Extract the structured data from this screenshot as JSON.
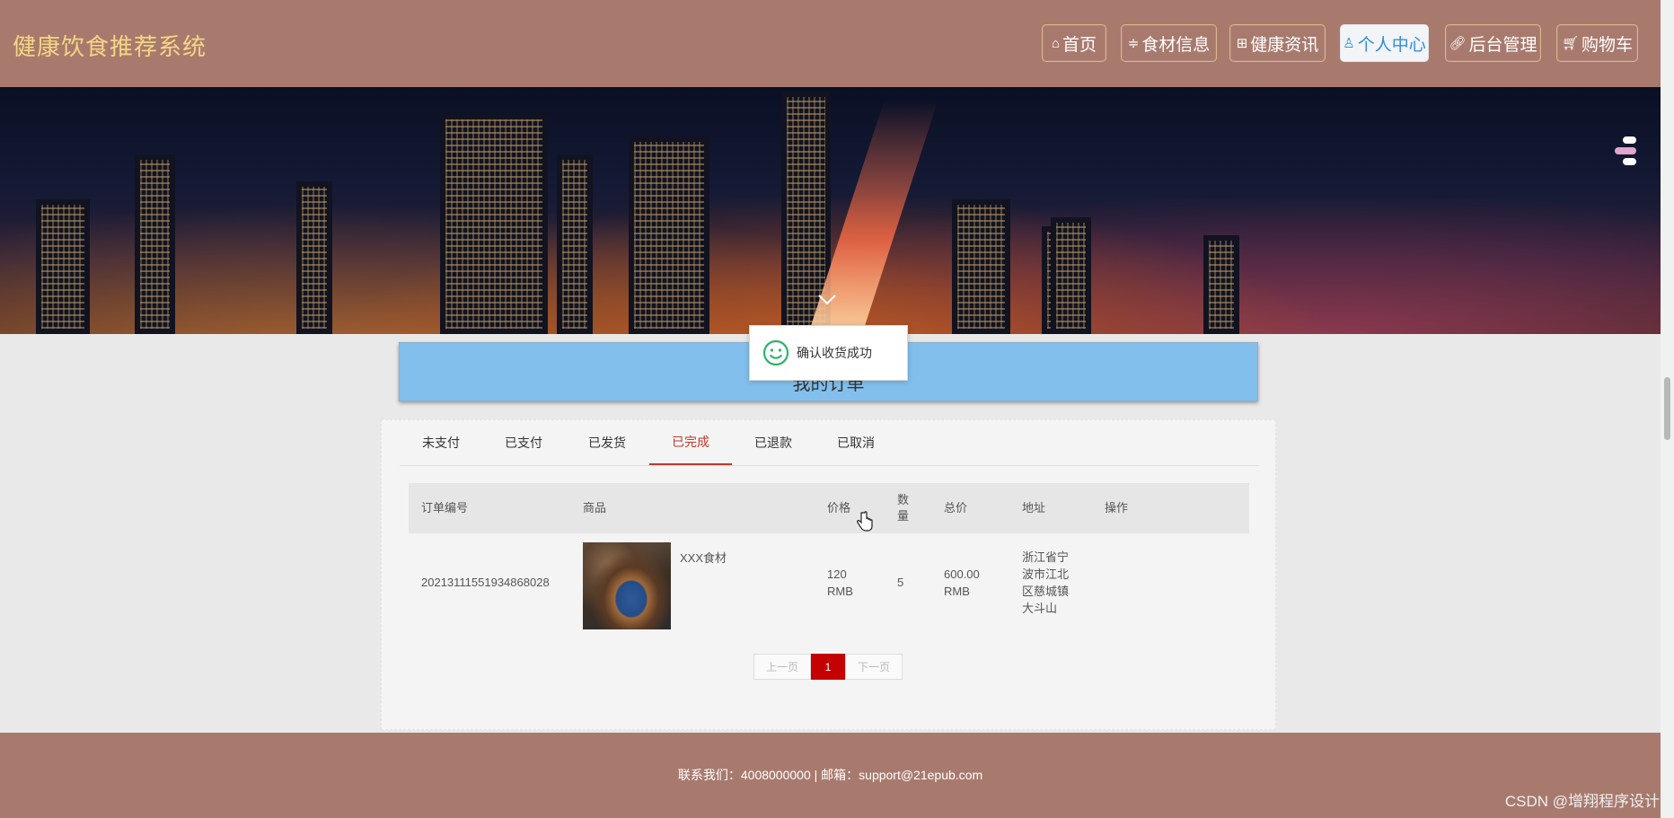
{
  "header": {
    "title": "健康饮食推荐系统",
    "nav": [
      {
        "label": "首页",
        "icon": "home-icon"
      },
      {
        "label": "食材信息",
        "icon": "sliders-icon"
      },
      {
        "label": "健康资讯",
        "icon": "gift-icon"
      },
      {
        "label": "个人中心",
        "icon": "user-icon",
        "active": true
      },
      {
        "label": "后台管理",
        "icon": "link-icon"
      },
      {
        "label": "购物车",
        "icon": "cart-icon"
      }
    ]
  },
  "section": {
    "title": "我的订单"
  },
  "toast": {
    "message": "确认收货成功"
  },
  "tabs": [
    "未支付",
    "已支付",
    "已发货",
    "已完成",
    "已退款",
    "已取消"
  ],
  "active_tab": "已完成",
  "table": {
    "headers": [
      "订单编号",
      "商品",
      "价格",
      "数量",
      "总价",
      "地址",
      "操作"
    ],
    "rows": [
      {
        "order_id": "202131115519348680​28",
        "product": "XXX食材",
        "price": "120 RMB",
        "quantity": "5",
        "total": "600.00 RMB",
        "address": "浙江省宁波市江北区慈城镇大斗山",
        "action": ""
      }
    ]
  },
  "pager": {
    "prev": "上一页",
    "current": "1",
    "next": "下一页"
  },
  "footer": {
    "text": "联系我们：4008000000 | 邮箱：support@21epub.com"
  },
  "watermark": "CSDN @增翔程序设计",
  "colors": {
    "header_bg": "#a87a6e",
    "title": "#f3d784",
    "accent": "#c40000",
    "section_bar": "#82bfed",
    "active_nav_text": "#2f8fd8"
  }
}
